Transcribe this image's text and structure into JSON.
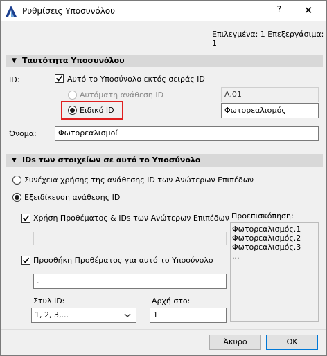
{
  "window": {
    "title": "Ρυθμίσεις Υποσυνόλου",
    "help_glyph": "?",
    "close_glyph": "✕"
  },
  "summary": "Επιλεγμένα: 1 Επεξεργάσιμα: 1",
  "identity": {
    "header": "Ταυτότητα Υποσυνόλου",
    "id_label": "ID:",
    "out_of_sequence_label": "Αυτό το Υποσύνολο εκτός σειράς ID",
    "out_of_sequence_checked": true,
    "auto_assign_label": "Αυτόματη ανάθεση ID",
    "auto_assign_value": "A.01",
    "custom_id_label": "Ειδικό ID",
    "custom_id_value": "Φωτορεαλισμός",
    "name_label": "Όνομα:",
    "name_value": "Φωτορεαλισμοί"
  },
  "element_ids": {
    "header": "IDs των στοιχείων σε αυτό το Υποσύνολο",
    "continue_label": "Συνέχεια χρήσης της ανάθεσης ID των Ανώτερων Επιπέδων",
    "customize_label": "Εξειδίκευση ανάθεσης ID",
    "customize_selected": true,
    "use_prefix_label": "Χρήση Προθέματος & IDs των Ανώτερων Επιπέδων",
    "use_prefix_checked": true,
    "use_prefix_value": "",
    "add_prefix_label": "Προσθήκη Προθέματος για αυτό το Υποσύνολο",
    "add_prefix_checked": true,
    "add_prefix_value": ".",
    "id_style_label": "Στυλ ID:",
    "id_style_value": "1, 2, 3,...",
    "start_at_label": "Αρχή στο:",
    "start_at_value": "1",
    "preview_label": "Προεπισκόπηση:",
    "preview_items": [
      "Φωτορεαλισμός.1",
      "Φωτορεαλισμός.2",
      "Φωτορεαλισμός.3",
      "..."
    ]
  },
  "footer": {
    "cancel_label": "Άκυρο",
    "ok_label": "OK"
  },
  "colors": {
    "highlight": "#e02020",
    "section_bg": "#d8d8d8",
    "ok_border": "#0078d7"
  },
  "icons": [
    "archicad-app-icon",
    "check-icon",
    "chevron-down-icon",
    "triangle-down-icon",
    "close-icon",
    "help-icon"
  ]
}
